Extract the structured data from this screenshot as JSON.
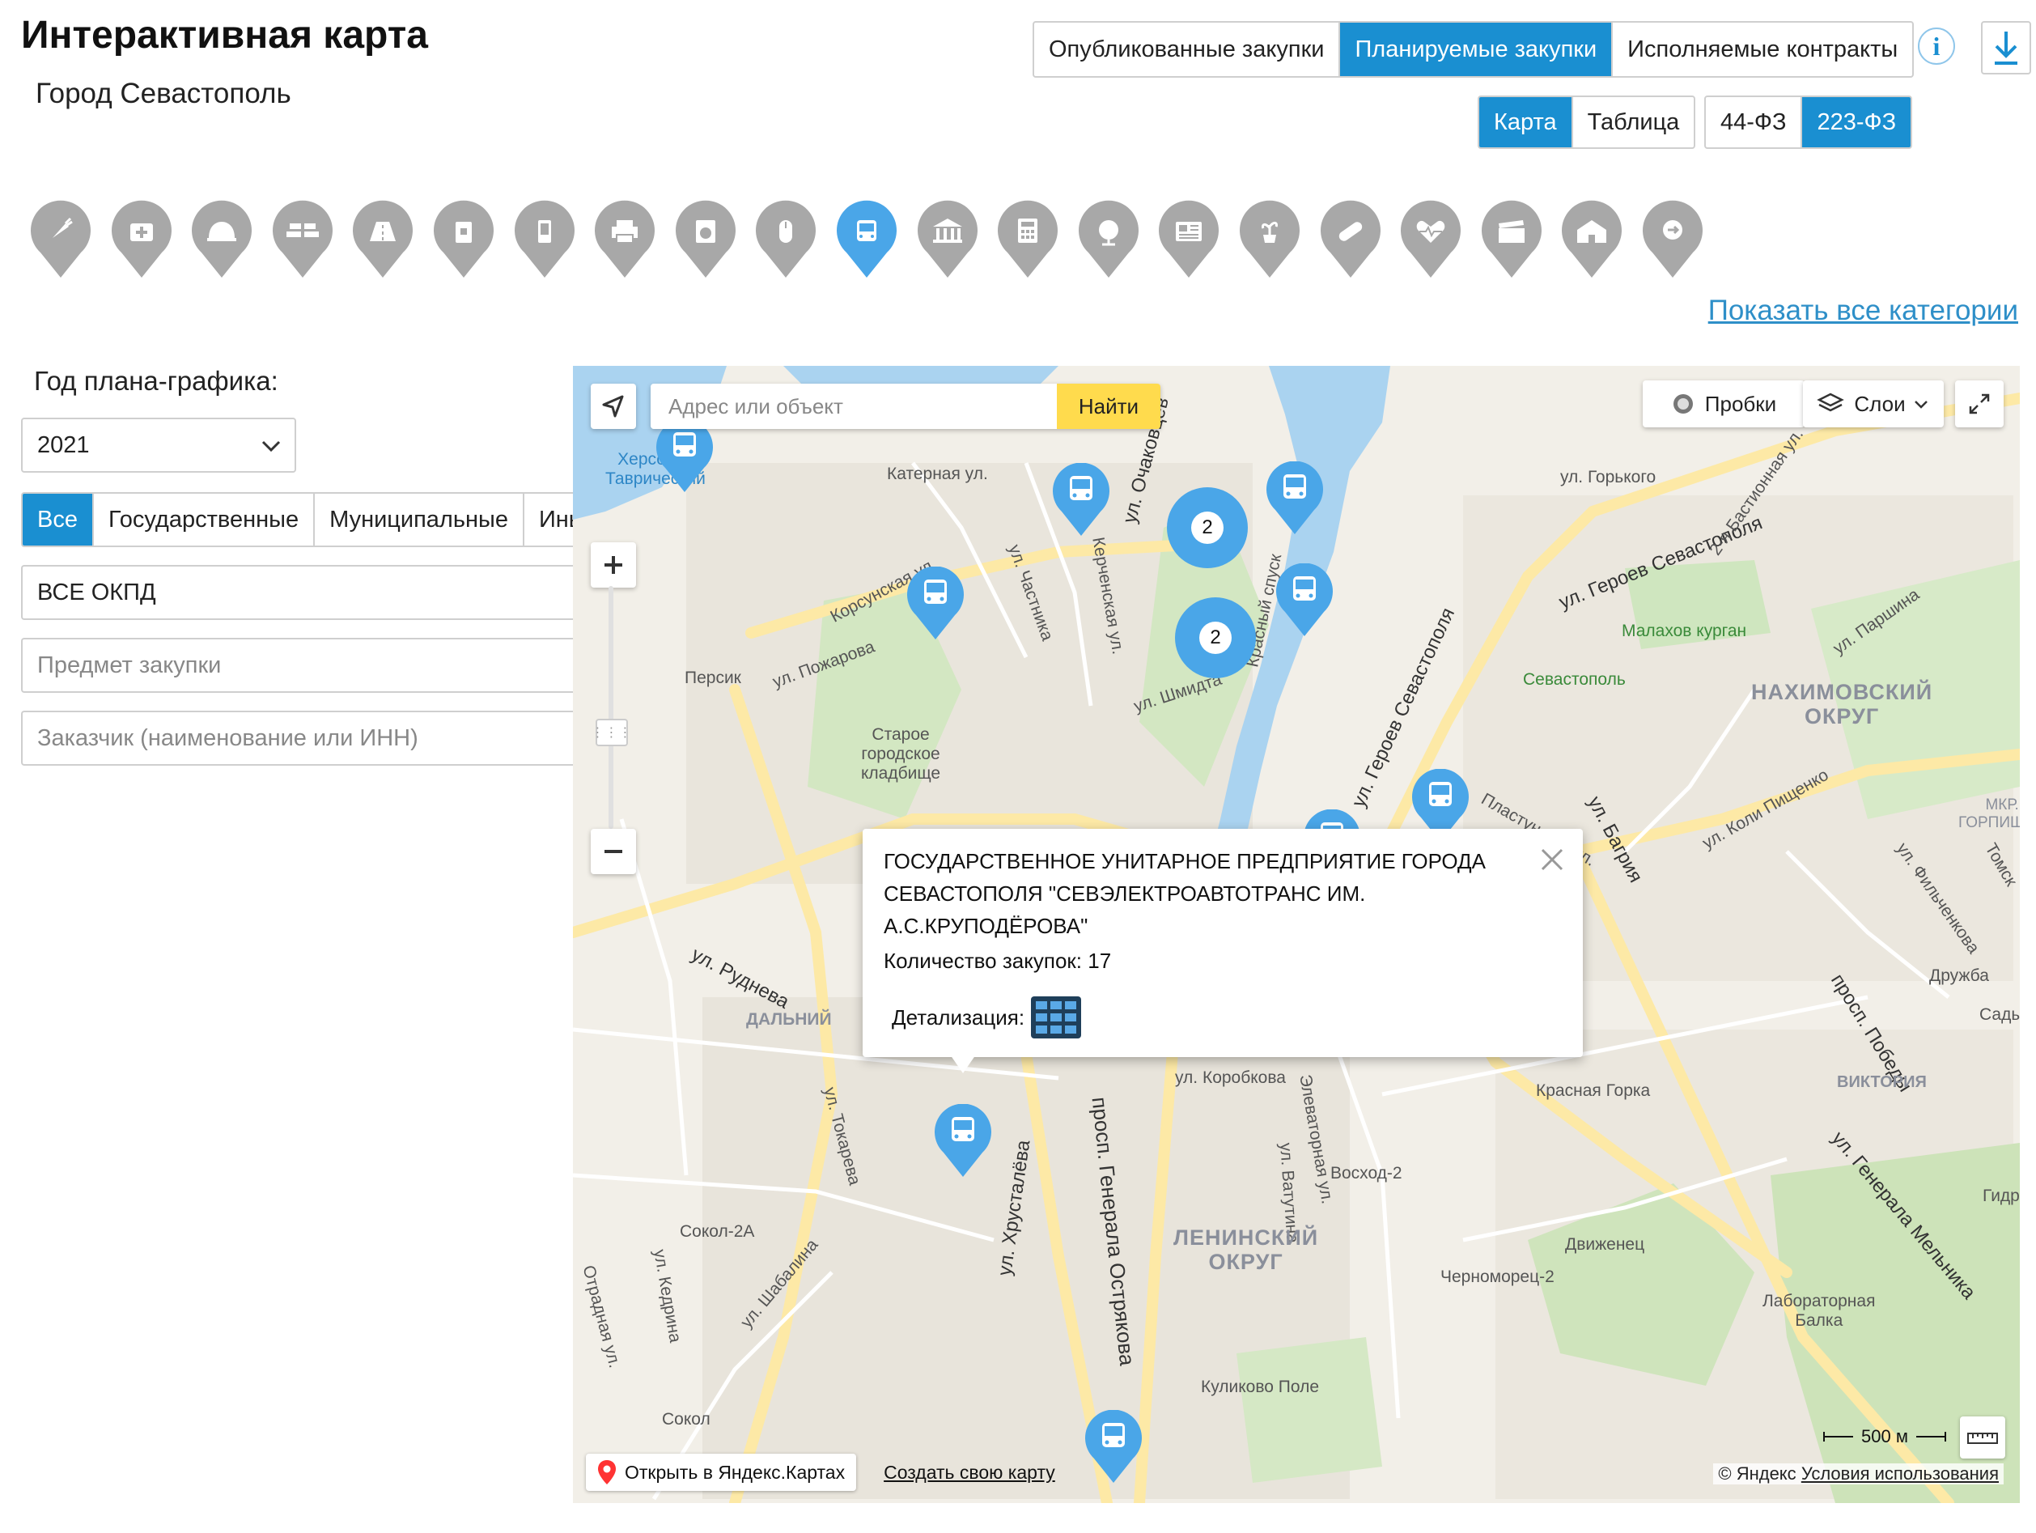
{
  "header": {
    "title": "Интерактивная карта",
    "subtitle": "Город Севастополь"
  },
  "procurement_tabs": [
    "Опубликованные закупки",
    "Планируемые закупки",
    "Исполняемые контракты"
  ],
  "procurement_tabs_active": 1,
  "view_tabs": [
    "Карта",
    "Таблица"
  ],
  "view_tabs_active": 0,
  "law_tabs": [
    "44-ФЗ",
    "223-ФЗ"
  ],
  "law_tabs_active": 1,
  "info_glyph": "i",
  "category_icons": [
    "carrot-icon",
    "medkit-icon",
    "hardhat-icon",
    "bricks-icon",
    "road-icon",
    "fuel-canister-icon",
    "phone-icon",
    "printer-icon",
    "washing-machine-icon",
    "mouse-icon",
    "bus-icon",
    "bank-icon",
    "calculator-icon",
    "globe-icon",
    "newspaper-icon",
    "plant-icon",
    "pill-icon",
    "heart-pulse-icon",
    "film-clapper-icon",
    "house-icon",
    "signpost-icon"
  ],
  "category_active_index": 10,
  "show_all_link": "Показать все категории",
  "sidebar": {
    "year_label": "Год плана-графика:",
    "year_value": "2021",
    "owner_tabs": [
      "Все",
      "Государственные",
      "Муниципальные",
      "Иные"
    ],
    "owner_tabs_active": 0,
    "okpd_value": "ВСЕ ОКПД",
    "subject_placeholder": "Предмет закупки",
    "customer_placeholder": "Заказчик (наименование или ИНН)"
  },
  "map": {
    "search_placeholder": "Адрес или объект",
    "find_button": "Найти",
    "traffic_button": "Пробки",
    "layers_button": "Слои",
    "open_in_yandex": "Открыть в Яндекс.Картах",
    "create_map": "Создать свою карту",
    "copyright": "© Яндекс",
    "terms_link": "Условия использования",
    "scale_label": "500 м",
    "clusters": [
      {
        "count": "2"
      },
      {
        "count": "2"
      }
    ],
    "labels": {
      "khersones": "Херсонес\nТаврический",
      "katernaya": "Катерная ул.",
      "korsunskaya": "Корсунская ул.",
      "pozharova": "ул. Пожарова",
      "persik": "Персик",
      "cemetery": "Старое\nгородское\nкладбище",
      "chastnika": "ул. Частника",
      "kerchenskaya": "Керченская ул.",
      "ochakovtsev": "ул. Очаковцев",
      "shmidta": "ул. Шмидта",
      "krasny_spusk": "Красный спуск",
      "geroev_sev": "ул. Героев Севастополя",
      "geroev_sev2": "ул. Героев Севастополя",
      "gorkogo": "ул. Горького",
      "bastionnaya": "2-я Бастионная ул.",
      "malakhov": "Малахов курган",
      "sevastopol_station": "Севастополь",
      "parshina": "ул. Паршина",
      "nakhimovsky": "НАХИМОВСКИЙ\nОКРУГ",
      "plastunskaya": "Пластунская ул.",
      "bagriya": "ул. Багрия",
      "koli_pishchenko": "ул. Коли Пищенко",
      "gorpishchenko": "МКР.\nГОРПИЩЕН",
      "rudneva": "ул. Руднева",
      "dalny": "ДАЛЬНИЙ",
      "tokareva": "ул. Токарева",
      "korobkova": "ул. Коробкова",
      "elevatornaya": "Элеваторная ул.",
      "vatutina": "ул. Ватутина",
      "voskhod": "Восход-2",
      "krasnaya_gorka": "Красная Горка",
      "pobedy": "просп. Победы",
      "druzhba": "Дружба",
      "sady": "Сады",
      "viktoriya": "ВИКТОРИЯ",
      "gen_melnika": "ул. Генерала Мельника",
      "gen_ostryakova": "просп. Генерала Острякова",
      "khrustaleva": "ул. Хрусталёва",
      "leninsky": "ЛЕНИНСКИЙ\nОКРУГ",
      "sokol": "Сокол-2А",
      "kedrina": "ул. Кедрина",
      "shabalina": "ул. Шабалина",
      "otradnaya": "Отрадная ул.",
      "dvizhenets": "Движенец",
      "chernomorets": "Черноморец-2",
      "lab_balka": "Лабораторная\nБалка",
      "kulikovo": "Куликово Поле",
      "sokol2": "Сокол",
      "fil": "ул. Фильченкова",
      "gidr": "Гидр",
      "tomsk": "Томск"
    }
  },
  "popup": {
    "org_name": "ГОСУДАРСТВЕННОЕ УНИТАРНОЕ ПРЕДПРИЯТИЕ ГОРОДА СЕВАСТОПОЛЯ \"СЕВЭЛЕКТРОАВТОТРАНС ИМ. А.С.КРУПОДЁРОВА\"",
    "count_text": "Количество закупок: 17",
    "detail_label": "Детализация:"
  },
  "colors": {
    "accent": "#1a8fd1",
    "marker": "#4aa6e8",
    "category_inactive": "#a8a8a8",
    "water": "#aad3f0",
    "park": "#cfe6bf",
    "road": "#fde9a6"
  }
}
